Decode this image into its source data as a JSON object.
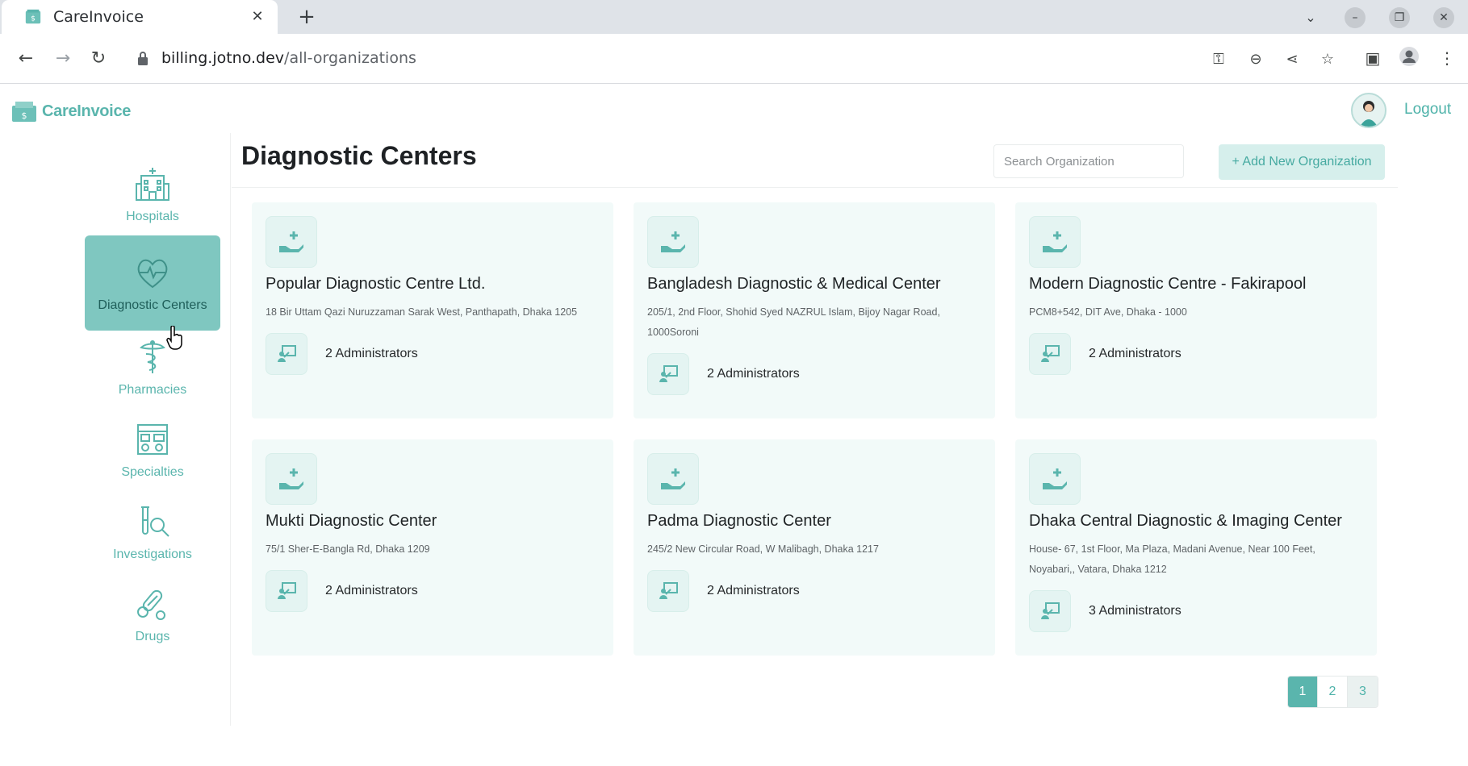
{
  "browser": {
    "tab_title": "CareInvoice",
    "url_host": "billing.jotno.dev",
    "url_path": "/all-organizations"
  },
  "app": {
    "logo_text": "CareInvoice",
    "logout_label": "Logout",
    "accent_color": "#5ab5ad"
  },
  "sidebar": {
    "items": [
      {
        "label": "Hospitals",
        "icon": "hospital-icon",
        "active": false
      },
      {
        "label": "Diagnostic Centers",
        "icon": "heart-pulse-icon",
        "active": true
      },
      {
        "label": "Pharmacies",
        "icon": "pharmacy-icon",
        "active": false
      },
      {
        "label": "Specialties",
        "icon": "specialties-icon",
        "active": false
      },
      {
        "label": "Investigations",
        "icon": "investigation-icon",
        "active": false
      },
      {
        "label": "Drugs",
        "icon": "drugs-icon",
        "active": false
      }
    ]
  },
  "main": {
    "title": "Diagnostic Centers",
    "search_placeholder": "Search Organization",
    "add_button_label": "+ Add New Organization",
    "organizations": [
      {
        "name": "Popular Diagnostic Centre Ltd.",
        "address": "18 Bir Uttam Qazi Nuruzzaman Sarak West, Panthapath, Dhaka 1205",
        "admins": "2 Administrators"
      },
      {
        "name": "Bangladesh Diagnostic & Medical Center",
        "address": "205/1, 2nd Floor, Shohid Syed NAZRUL Islam, Bijoy Nagar Road, 1000Soroni",
        "admins": "2 Administrators"
      },
      {
        "name": "Modern Diagnostic Centre - Fakirapool",
        "address": "PCM8+542, DIT Ave, Dhaka - 1000",
        "admins": "2 Administrators"
      },
      {
        "name": "Mukti Diagnostic Center",
        "address": "75/1 Sher-E-Bangla Rd, Dhaka 1209",
        "admins": "2 Administrators"
      },
      {
        "name": "Padma Diagnostic Center",
        "address": "245/2 New Circular Road, W Malibagh, Dhaka 1217",
        "admins": "2 Administrators"
      },
      {
        "name": "Dhaka Central Diagnostic & Imaging Center",
        "address": "House- 67, 1st Floor, Ma Plaza, Madani Avenue, Near 100 Feet, Noyabari,, Vatara, Dhaka 1212",
        "admins": "3 Administrators"
      }
    ],
    "pagination": {
      "pages": [
        "1",
        "2",
        "3"
      ],
      "current": "1"
    }
  }
}
